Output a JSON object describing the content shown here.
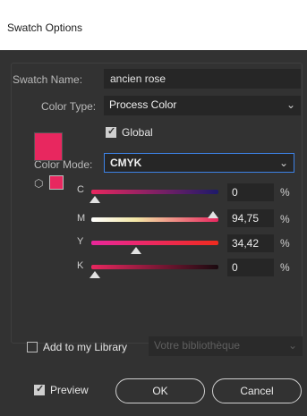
{
  "window": {
    "title": "Swatch Options"
  },
  "swatch_name": {
    "label": "Swatch Name:",
    "value": "ancien rose"
  },
  "color_type": {
    "label": "Color Type:",
    "selected": "Process Color"
  },
  "global": {
    "label": "Global",
    "checked": true
  },
  "color_mode": {
    "label": "Color Mode:",
    "selected": "CMYK"
  },
  "swatch": {
    "color": "#e8275f"
  },
  "channels": [
    {
      "label": "C",
      "value": "0",
      "unit": "%",
      "level": 0
    },
    {
      "label": "M",
      "value": "94,75",
      "unit": "%",
      "level": 0.9475
    },
    {
      "label": "Y",
      "value": "34,42",
      "unit": "%",
      "level": 0.3442
    },
    {
      "label": "K",
      "value": "0",
      "unit": "%",
      "level": 0
    }
  ],
  "library": {
    "label": "Add to my Library",
    "checked": false,
    "placeholder": "Votre bibliothèque"
  },
  "preview": {
    "label": "Preview",
    "checked": true
  },
  "buttons": {
    "ok": "OK",
    "cancel": "Cancel"
  },
  "icons": {
    "dropdown": "chevron-down-icon",
    "gamut": "cube-icon"
  }
}
